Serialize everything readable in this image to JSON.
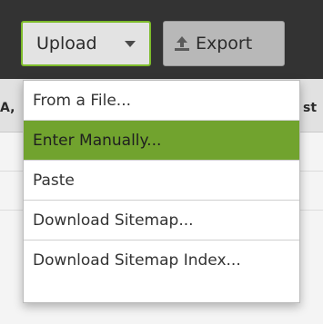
{
  "toolbar": {
    "upload_label": "Upload",
    "export_label": "Export",
    "export_icon": "upload-icon",
    "upload_caret_icon": "caret-down-icon"
  },
  "table_header": {
    "left_fragment": "A,",
    "right_fragment": "st"
  },
  "upload_menu": {
    "items": [
      {
        "label": "From a File..."
      },
      {
        "label": "Enter Manually...",
        "highlighted": true
      },
      {
        "label": "Paste"
      },
      {
        "label": "Download Sitemap..."
      },
      {
        "label": "Download Sitemap Index..."
      }
    ]
  },
  "colors": {
    "accent_green": "#71a32e",
    "active_border_green": "#7dbb2a",
    "topbar_dark": "#333333"
  }
}
